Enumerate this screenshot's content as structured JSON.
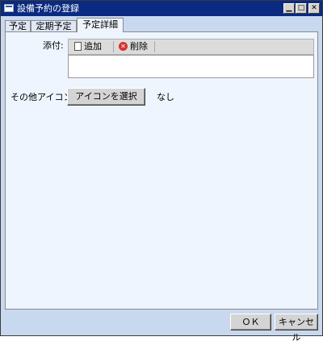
{
  "window": {
    "title": "設備予約の登録"
  },
  "tabs": [
    {
      "label": "予定"
    },
    {
      "label": "定期予定"
    },
    {
      "label": "予定詳細"
    }
  ],
  "details": {
    "attachment_label": "添付:",
    "add_label": "追加",
    "delete_label": "削除",
    "other_icon_label": "その他アイコン:",
    "select_icon_label": "アイコンを選択",
    "icon_value": "なし"
  },
  "footer": {
    "ok_label": "ＯＫ",
    "cancel_label": "キャンセル"
  },
  "colors": {
    "titlebar": "#0a2a82",
    "panel": "#eef5fe",
    "frame": "#c8d8ee"
  }
}
